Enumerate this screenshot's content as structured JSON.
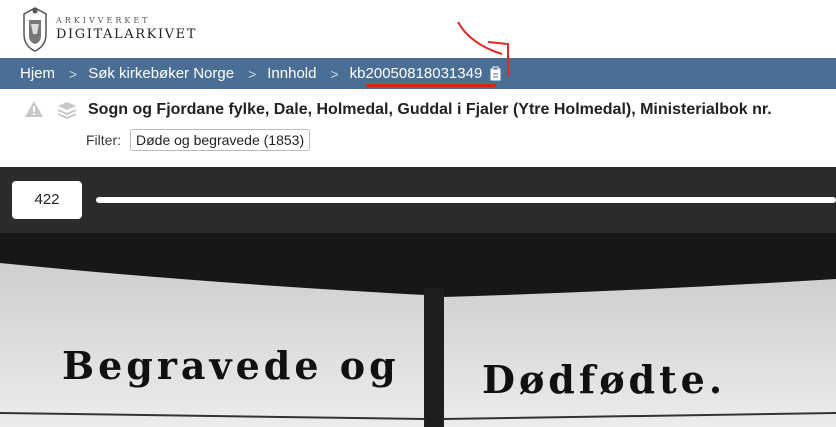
{
  "logo": {
    "small": "ARKIVVERKET",
    "big": "DIGITALARKIVET"
  },
  "breadcrumb": [
    "Hjem",
    "Søk kirkebøker Norge",
    "Innhold",
    "kb20050818031349"
  ],
  "header": {
    "title": "Sogn og Fjordane fylke, Dale, Holmedal, Guddal i Fjaler (Ytre Holmedal), Ministerialbok nr.",
    "filter_label": "Filter:",
    "filter_value": "Døde og begravede (1853)"
  },
  "viewer": {
    "page_number": "422",
    "page_fraction": 1
  },
  "scan_text": {
    "left": "Begravede og",
    "right": "Dødfødte."
  },
  "colors": {
    "nav": "#4b6e94",
    "underline": "#d9241e",
    "viewer": "#2b2b2b"
  }
}
